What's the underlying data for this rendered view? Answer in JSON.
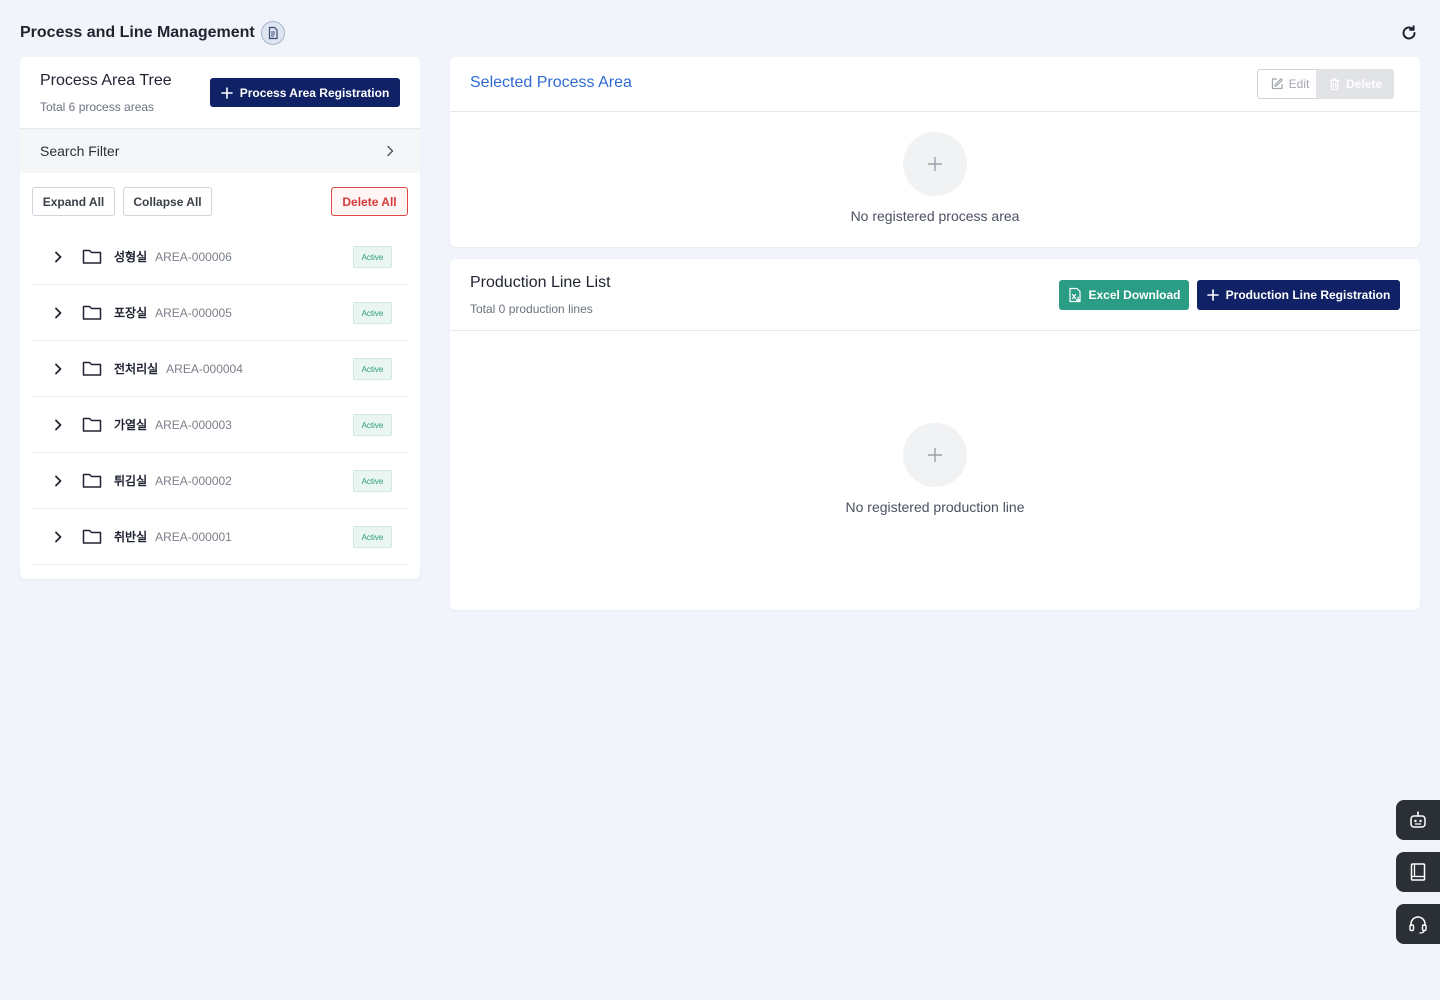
{
  "page": {
    "title": "Process and Line Management"
  },
  "tree": {
    "title": "Process Area Tree",
    "subtitle": "Total 6 process areas",
    "register_label": "Process Area Registration",
    "search_filter_label": "Search Filter",
    "expand_all_label": "Expand All",
    "collapse_all_label": "Collapse All",
    "delete_all_label": "Delete All",
    "items": [
      {
        "name": "성형실",
        "code": "AREA-000006",
        "status": "Active"
      },
      {
        "name": "포장실",
        "code": "AREA-000005",
        "status": "Active"
      },
      {
        "name": "전처리실",
        "code": "AREA-000004",
        "status": "Active"
      },
      {
        "name": "가열실",
        "code": "AREA-000003",
        "status": "Active"
      },
      {
        "name": "튀김실",
        "code": "AREA-000002",
        "status": "Active"
      },
      {
        "name": "취반실",
        "code": "AREA-000001",
        "status": "Active"
      }
    ]
  },
  "selected_area": {
    "title": "Selected Process Area",
    "edit_label": "Edit",
    "delete_label": "Delete",
    "empty_text": "No registered process area"
  },
  "production_lines": {
    "title": "Production Line List",
    "subtitle": "Total 0 production lines",
    "excel_label": "Excel Download",
    "register_label": "Production Line Registration",
    "empty_text": "No registered production line"
  },
  "colors": {
    "primary": "#112166",
    "excel": "#2a9d84",
    "danger": "#d73a3a",
    "active_badge": "#2a9d73",
    "link_title": "#2f6bd1"
  },
  "icons": {
    "refresh": "refresh-icon",
    "doc": "document-icon",
    "robot": "robot-icon",
    "book": "book-icon",
    "headset": "headset-icon"
  }
}
